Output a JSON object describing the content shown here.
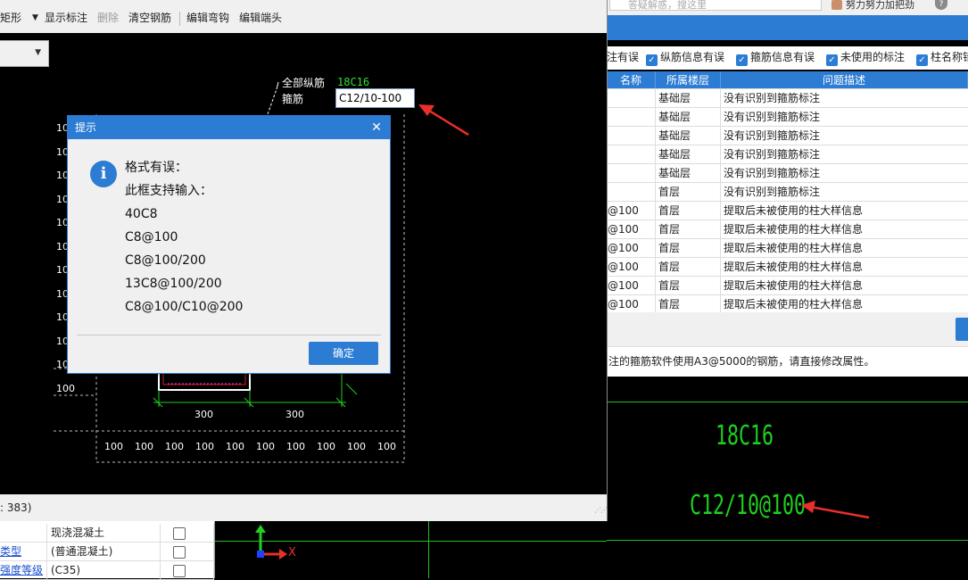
{
  "right_window": {
    "search_placeholder": "答疑解惑，搜这里",
    "user_name": "努力努力加把劲",
    "help_icon": "?",
    "filters": [
      {
        "label": "注有误",
        "checked": true
      },
      {
        "label": "纵筋信息有误",
        "checked": true
      },
      {
        "label": "箍筋信息有误",
        "checked": true
      },
      {
        "label": "未使用的标注",
        "checked": true
      },
      {
        "label": "柱名称错",
        "checked": true
      }
    ],
    "table": {
      "headers": [
        "名称",
        "所属楼层",
        "问题描述"
      ],
      "rows": [
        [
          "",
          "基础层",
          "没有识别到箍筋标注"
        ],
        [
          "",
          "基础层",
          "没有识别到箍筋标注"
        ],
        [
          "",
          "基础层",
          "没有识别到箍筋标注"
        ],
        [
          "",
          "基础层",
          "没有识别到箍筋标注"
        ],
        [
          "",
          "基础层",
          "没有识别到箍筋标注"
        ],
        [
          "",
          "首层",
          "没有识别到箍筋标注"
        ],
        [
          "@100",
          "首层",
          "提取后未被使用的柱大样信息"
        ],
        [
          "@100",
          "首层",
          "提取后未被使用的柱大样信息"
        ],
        [
          "@100",
          "首层",
          "提取后未被使用的柱大样信息"
        ],
        [
          "@100",
          "首层",
          "提取后未被使用的柱大样信息"
        ],
        [
          "@100",
          "首层",
          "提取后未被使用的柱大样信息"
        ],
        [
          "@100",
          "首层",
          "提取后未被使用的柱大样信息"
        ]
      ]
    },
    "note": "注的箍筋软件使用A3@5000的钢筋，请直接修改属性。",
    "cad_labels": {
      "longitudinal": "18C16",
      "stirrup": "C12/10@100"
    }
  },
  "properties": {
    "rows": [
      {
        "key": "",
        "value": "现浇混凝土"
      },
      {
        "key": "类型",
        "value": "(普通混凝土)"
      },
      {
        "key": "强度等级",
        "value": "(C35)"
      }
    ]
  },
  "axis": {
    "x_label": "X"
  },
  "editor": {
    "toolbar": [
      {
        "label": "矩形",
        "disabled": false
      },
      {
        "label": "显示标注",
        "disabled": false
      },
      {
        "label": "删除",
        "disabled": true
      },
      {
        "label": "清空钢筋",
        "disabled": false
      },
      {
        "label": "编辑弯钩",
        "disabled": false
      },
      {
        "label": "编辑端头",
        "disabled": false
      }
    ],
    "status_text": ": 383)",
    "labels": {
      "all_longitudinal": "全部纵筋",
      "all_longitudinal_value": "18C16",
      "stirrup": "箍筋",
      "stirrup_input_value": "C12/10-100"
    },
    "dims": {
      "left_ticks": [
        "100",
        "100",
        "100",
        "100",
        "100",
        "100",
        "100",
        "100",
        "100",
        "100",
        "100",
        "100"
      ],
      "bottom_ticks": [
        "100",
        "100",
        "100",
        "100",
        "100",
        "100",
        "100",
        "100",
        "100",
        "100"
      ],
      "span_1": "300",
      "span_2": "300"
    }
  },
  "dialog": {
    "title": "提示",
    "info_icon": "i",
    "lines": [
      "格式有误：",
      "此框支持输入：",
      "40C8",
      "C8@100",
      "C8@100/200",
      "13C8@100/200",
      "C8@100/C10@200"
    ],
    "ok_label": "确定"
  },
  "colors": {
    "accent": "#2c7cd4",
    "cad_green": "#1ed01e",
    "arrow_red": "#e8302a"
  }
}
